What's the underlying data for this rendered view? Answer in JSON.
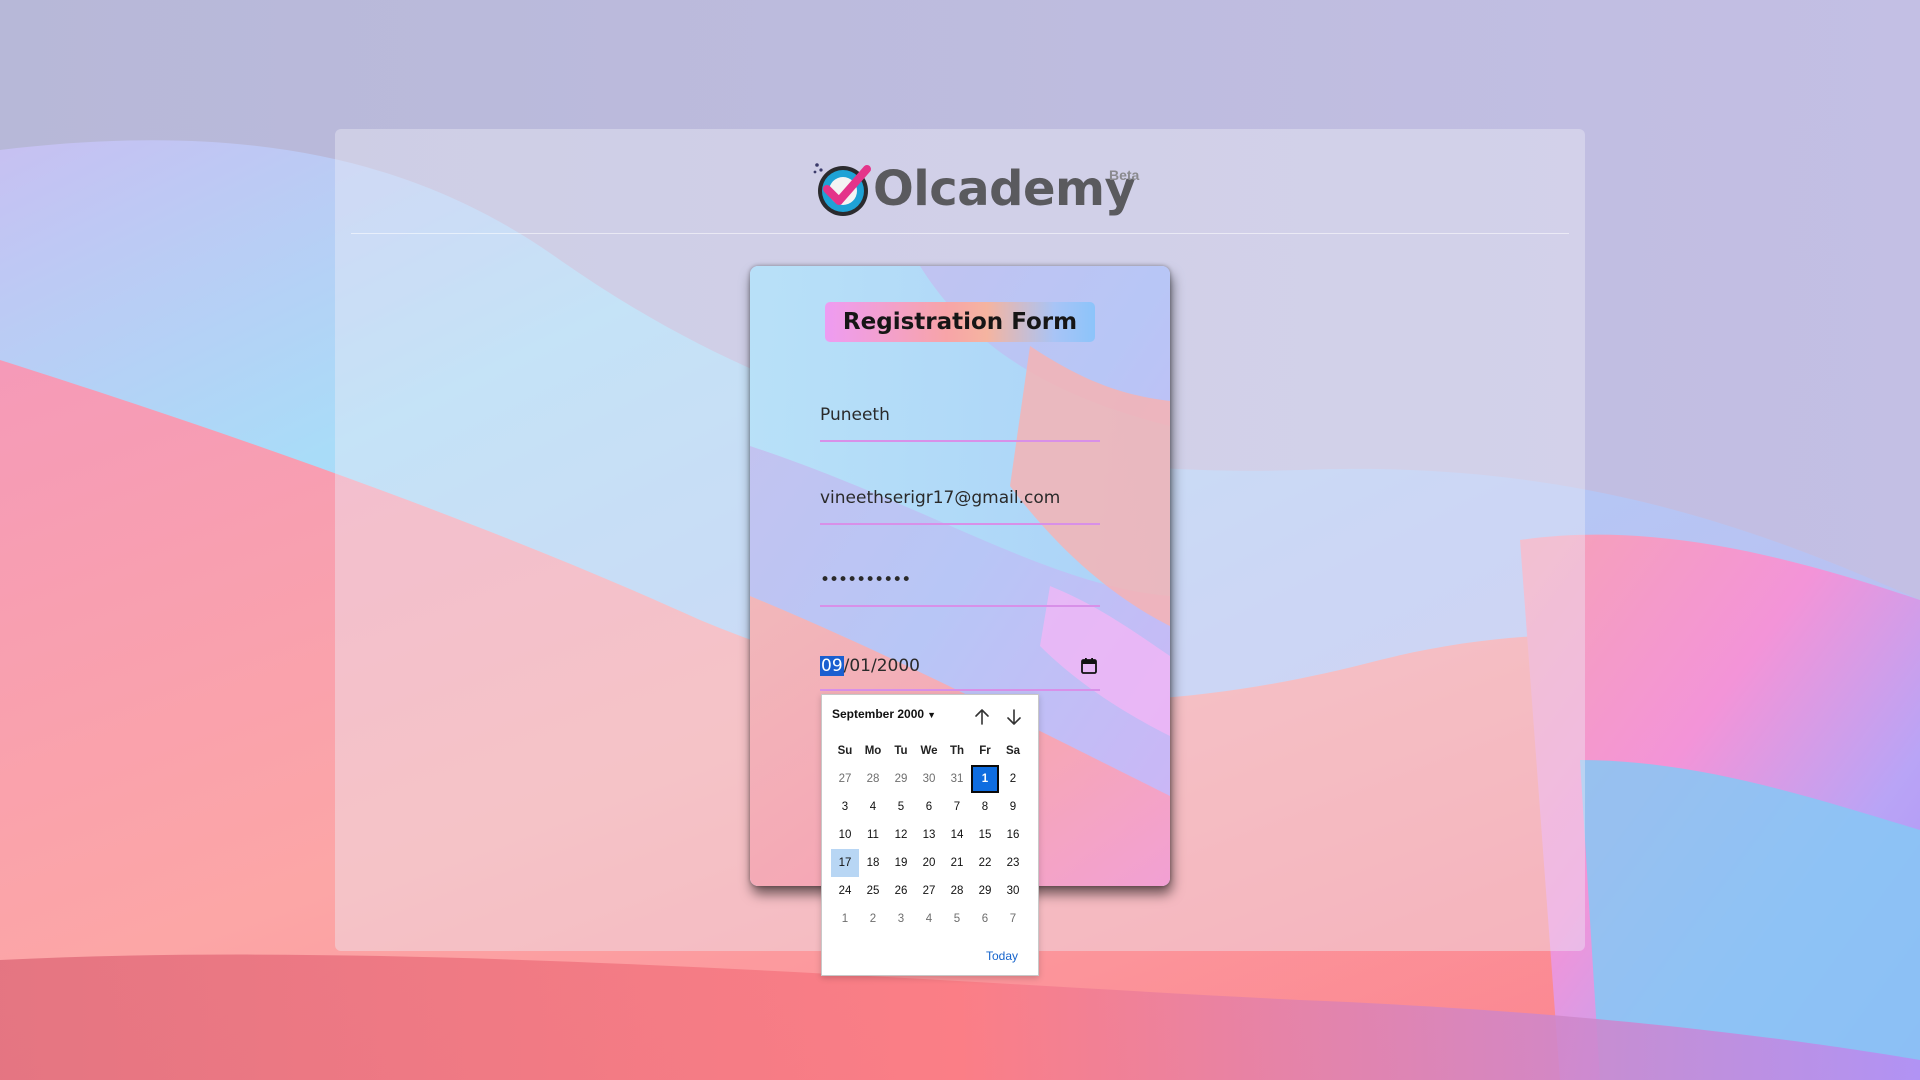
{
  "app": {
    "logo_text": "Olcademy",
    "logo_badge": "Beta"
  },
  "form": {
    "title": "Registration Form",
    "name_value": "Puneeth",
    "email_value": "vineethserigr17@gmail.com",
    "password_value": "••••••••••",
    "date": {
      "month_segment": "09",
      "rest": "/01/2000"
    }
  },
  "datepicker": {
    "month_label": "September 2000",
    "weekdays": [
      "Su",
      "Mo",
      "Tu",
      "We",
      "Th",
      "Fr",
      "Sa"
    ],
    "weeks": [
      [
        "27",
        "28",
        "29",
        "30",
        "31",
        "1",
        "2"
      ],
      [
        "3",
        "4",
        "5",
        "6",
        "7",
        "8",
        "9"
      ],
      [
        "10",
        "11",
        "12",
        "13",
        "14",
        "15",
        "16"
      ],
      [
        "17",
        "18",
        "19",
        "20",
        "21",
        "22",
        "23"
      ],
      [
        "24",
        "25",
        "26",
        "27",
        "28",
        "29",
        "30"
      ],
      [
        "1",
        "2",
        "3",
        "4",
        "5",
        "6",
        "7"
      ]
    ],
    "selected_day": "1",
    "highlighted_day": "17",
    "today_label": "Today"
  },
  "colors": {
    "accent": "#0f6de0",
    "field_underline": "#d890e8",
    "logo_text": "#5a5a5e"
  }
}
